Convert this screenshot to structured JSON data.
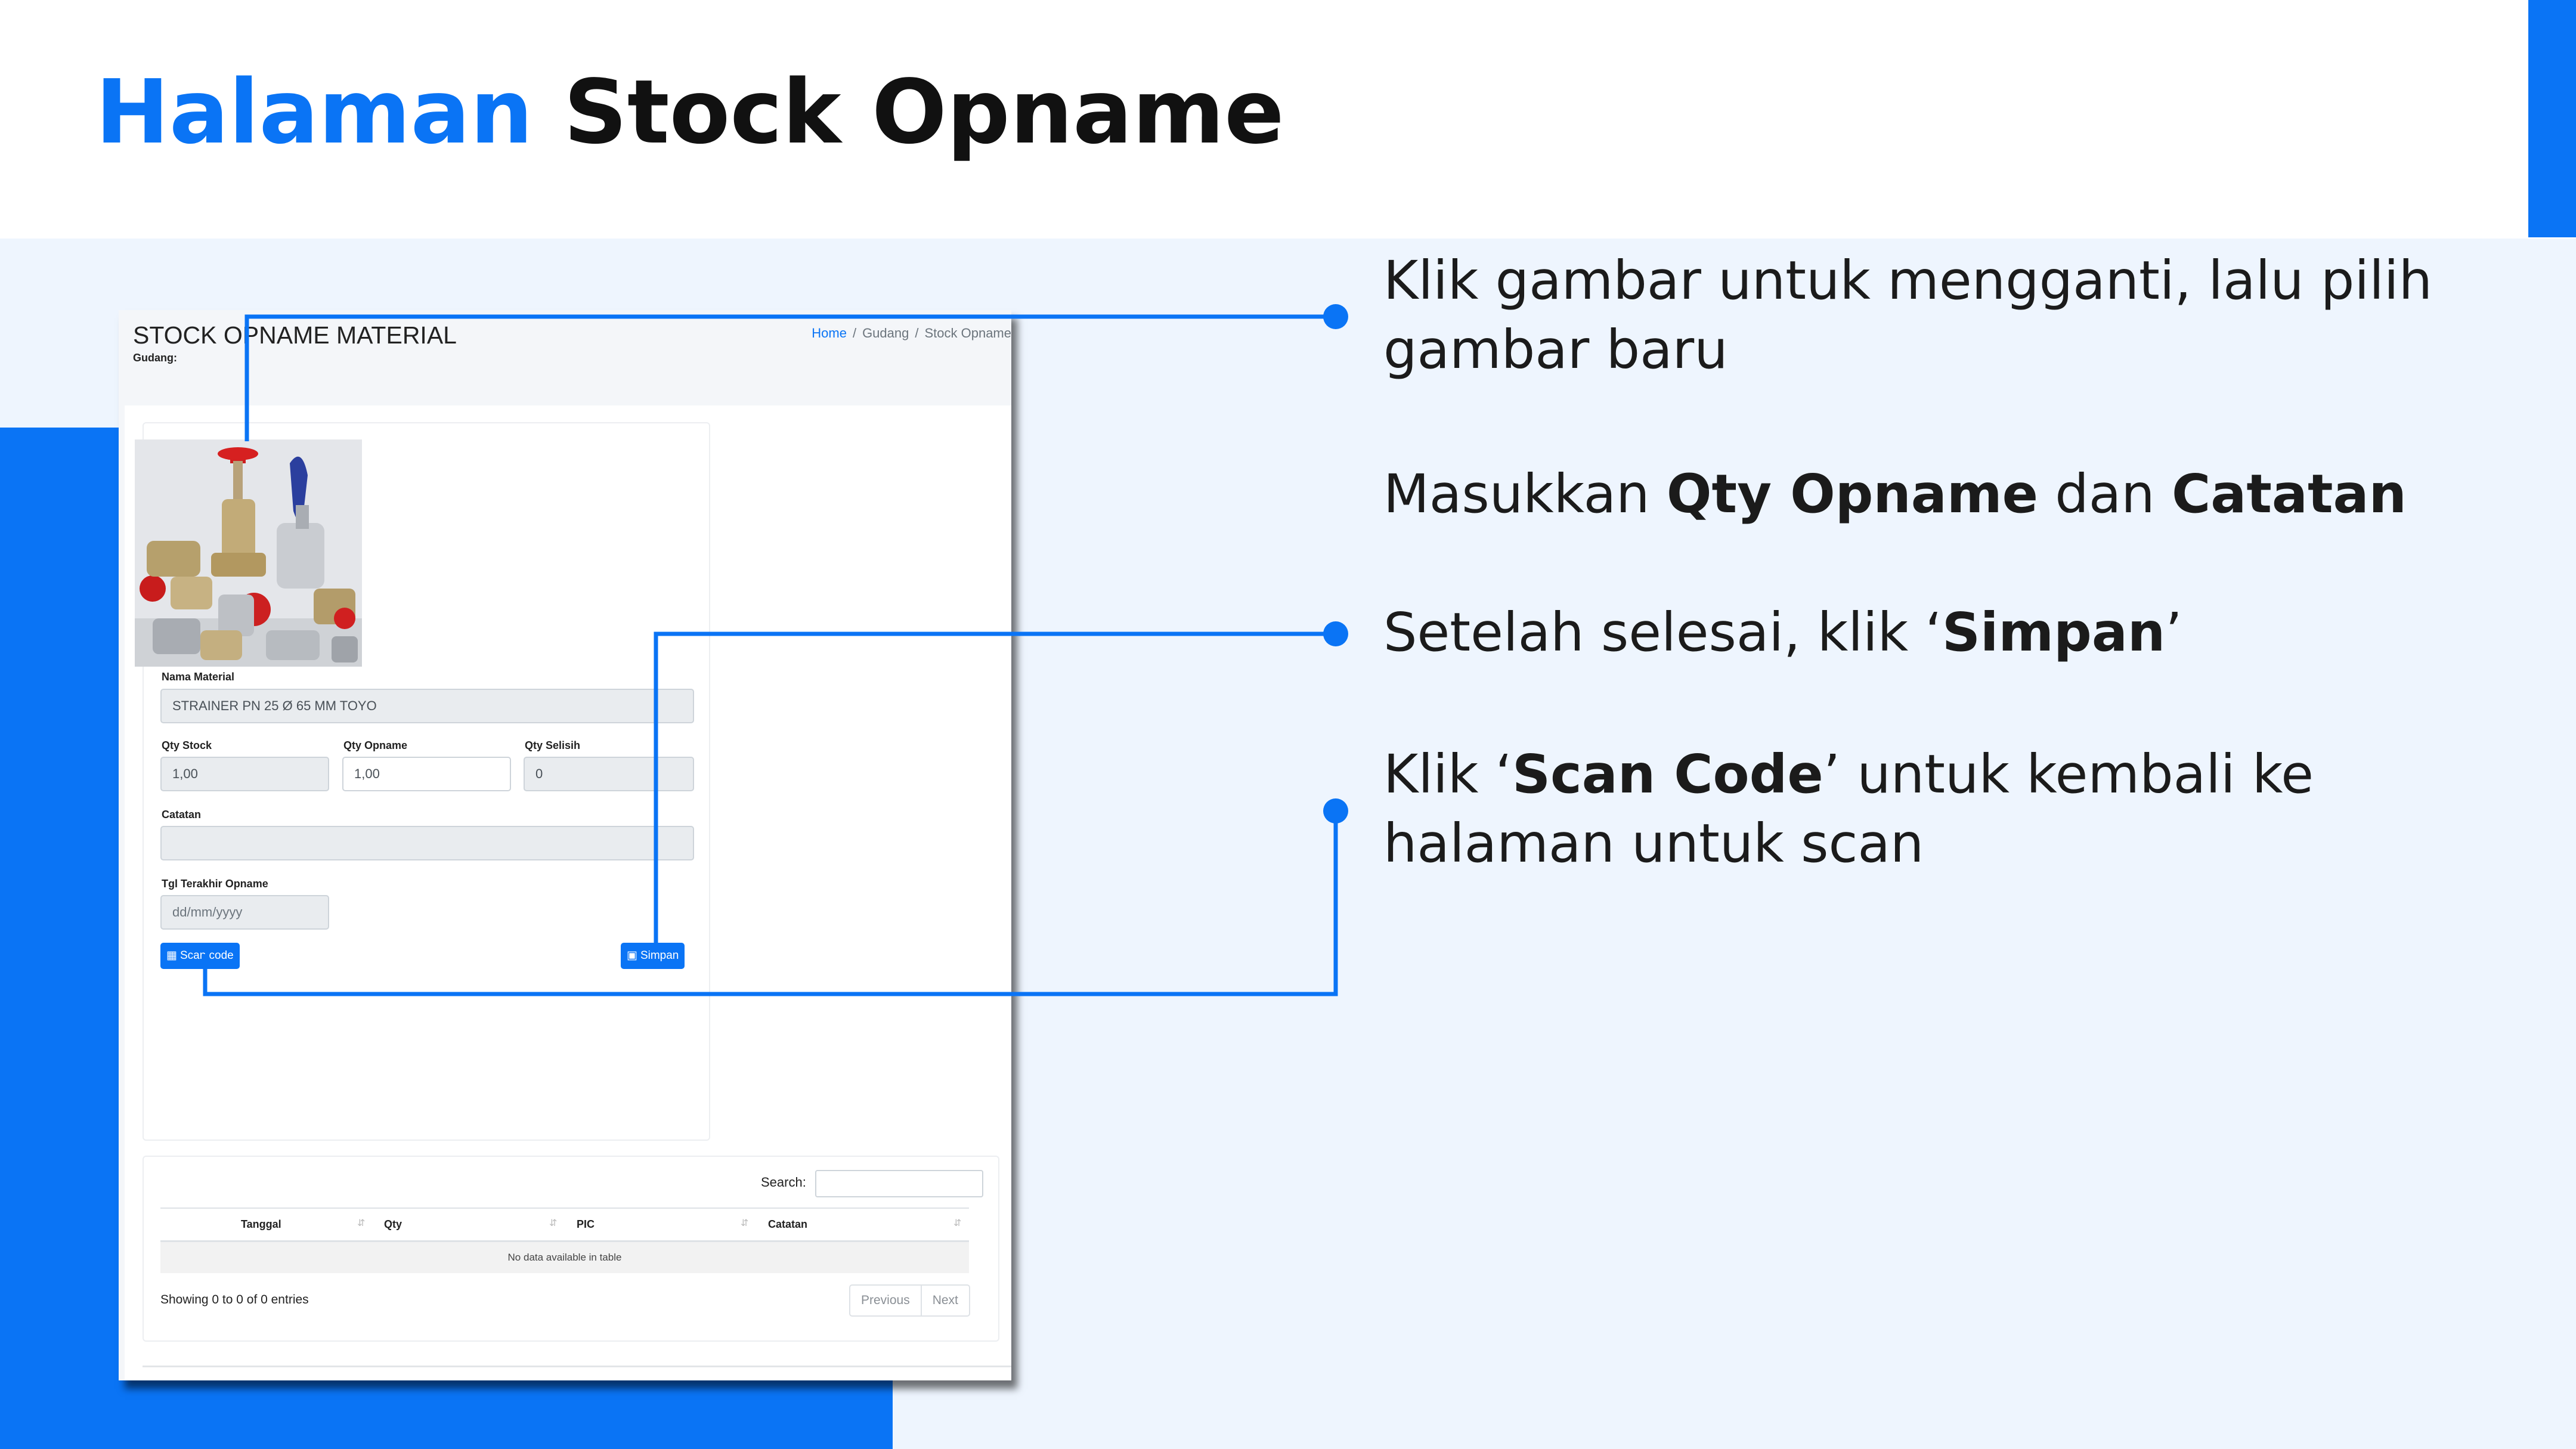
{
  "slide": {
    "title_highlight": "Halaman",
    "title_rest": "Stock Opname",
    "accent_color": "#0a74f5"
  },
  "screen": {
    "page_title": "STOCK OPNAME MATERIAL",
    "warehouse_label": "Gudang:",
    "breadcrumb": {
      "home": "Home",
      "separator": "/",
      "section": "Gudang",
      "current": "Stock Opname"
    },
    "material_image": "pipe-valves-and-fittings-photo",
    "nama_material": {
      "label": "Nama Material",
      "value": "STRAINER PN 25 Ø 65 MM TOYO"
    },
    "qty_stock": {
      "label": "Qty Stock",
      "value": "1,00"
    },
    "qty_opname": {
      "label": "Qty Opname",
      "value": "1,00"
    },
    "qty_selisih": {
      "label": "Qty Selisih",
      "value": "0"
    },
    "catatan": {
      "label": "Catatan",
      "value": ""
    },
    "tgl_terakhir": {
      "label": "Tgl Terakhir Opname",
      "placeholder": "dd/mm/yyyy"
    },
    "scan_button": {
      "icon": "qrcode-icon",
      "label": "Scan code"
    },
    "save_button": {
      "icon": "floppy-disk-icon",
      "label": "Simpan"
    },
    "history_table": {
      "search_label": "Search:",
      "search_value": "",
      "columns": [
        "Tanggal",
        "Qty",
        "PIC",
        "Catatan"
      ],
      "empty_message": "No data available in table",
      "info": "Showing 0 to 0 of 0 entries",
      "prev_label": "Previous",
      "next_label": "Next"
    }
  },
  "instructions": {
    "step1": "Klik gambar untuk mengganti, lalu pilih gambar baru",
    "step2_pre": "Masukkan ",
    "step2_qty": "Qty Opname",
    "step2_mid": " dan ",
    "step2_note": "Catatan",
    "step3_pre": "Setelah selesai, klik ‘",
    "step3_btn": "Simpan",
    "step3_post": "’",
    "step4_pre": "Klik ‘",
    "step4_btn": "Scan Code",
    "step4_post": "’ untuk kembali ke halaman untuk scan"
  }
}
